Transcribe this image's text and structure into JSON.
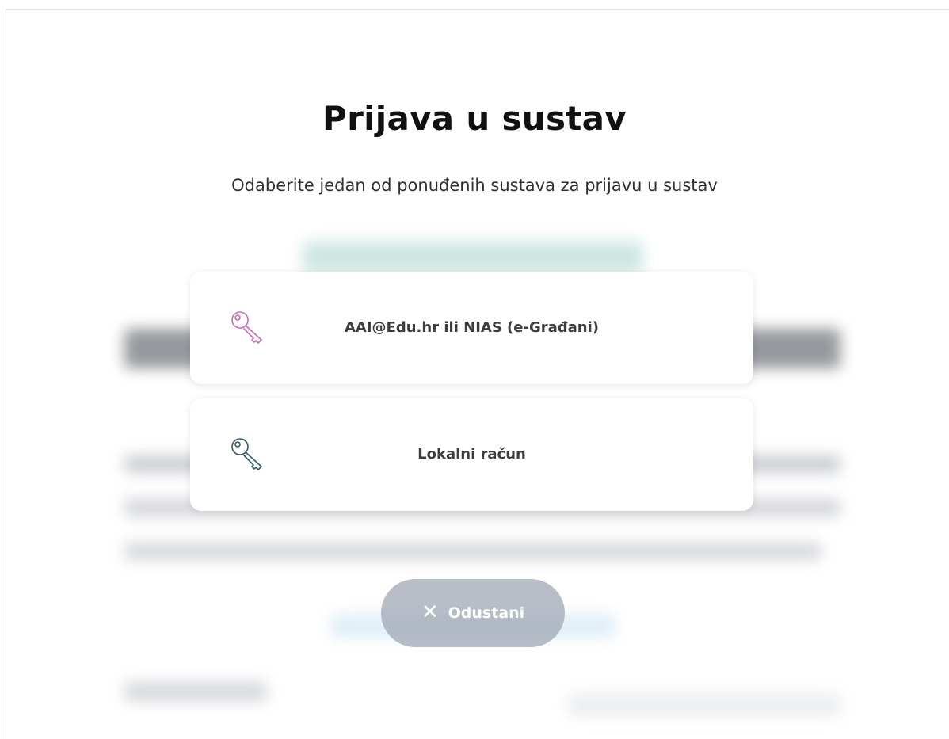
{
  "modal": {
    "title": "Prijava u sustav",
    "subtitle": "Odaberite jedan od ponuđenih sustava za prijavu u sustav",
    "options": [
      {
        "label": "AAI@Edu.hr ili NIAS (e-Građani)",
        "icon": "key-icon",
        "icon_color": "#c96bb4"
      },
      {
        "label": "Lokalni račun",
        "icon": "key-icon",
        "icon_color": "#2e5a68"
      }
    ],
    "cancel": {
      "label": "Odustani",
      "icon": "close-icon"
    }
  }
}
